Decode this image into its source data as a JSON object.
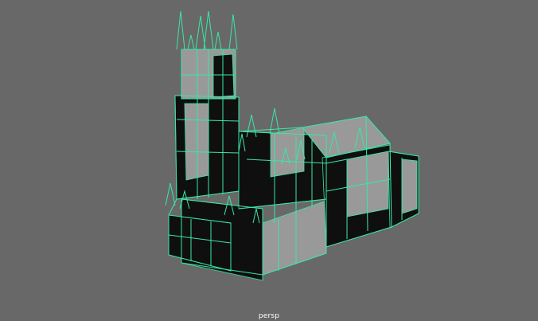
{
  "viewport": {
    "camera_label": "persp",
    "background_color": "#686868",
    "wireframe_color": "#39e8a6",
    "shaded_color": "#999999",
    "shadow_color": "#0f0f0f"
  }
}
